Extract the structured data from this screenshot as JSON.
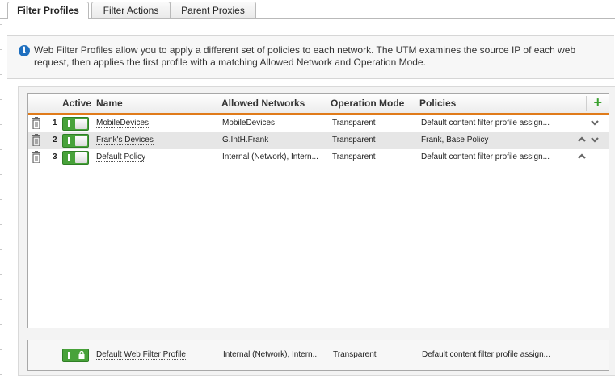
{
  "tabs": [
    {
      "label": "Filter Profiles",
      "active": true
    },
    {
      "label": "Filter Actions",
      "active": false
    },
    {
      "label": "Parent Proxies",
      "active": false
    }
  ],
  "info": {
    "icon": "info-icon",
    "text": "Web Filter Profiles allow you to apply a different set of policies to each network. The UTM examines the source IP of each web request, then applies the first profile with a matching Allowed Network and Operation Mode."
  },
  "grid": {
    "headers": {
      "active": "Active",
      "name": "Name",
      "allowed_networks": "Allowed Networks",
      "operation_mode": "Operation Mode",
      "policies": "Policies"
    },
    "add_icon": "plus-icon",
    "rows": [
      {
        "num": "1",
        "name": "MobileDevices",
        "allowed_networks": "MobileDevices",
        "operation_mode": "Transparent",
        "policies": "Default content filter profile assign...",
        "active": true,
        "up": false,
        "down": true
      },
      {
        "num": "2",
        "name": "Frank's Devices",
        "allowed_networks": "G.IntH.Frank",
        "operation_mode": "Transparent",
        "policies": "Frank, Base Policy",
        "active": true,
        "up": true,
        "down": true
      },
      {
        "num": "3",
        "name": "Default Policy",
        "allowed_networks": "Internal (Network), Intern...",
        "operation_mode": "Transparent",
        "policies": "Default content filter profile assign...",
        "active": true,
        "up": true,
        "down": false
      }
    ]
  },
  "default_profile": {
    "name": "Default Web Filter Profile",
    "allowed_networks": "Internal (Network), Intern...",
    "operation_mode": "Transparent",
    "policies": "Default content filter profile assign...",
    "active": true,
    "locked": true
  },
  "colors": {
    "accent_orange": "#e07b1a",
    "toggle_green": "#48a23a",
    "info_blue": "#1f6fbf",
    "add_green": "#3aa12f"
  }
}
